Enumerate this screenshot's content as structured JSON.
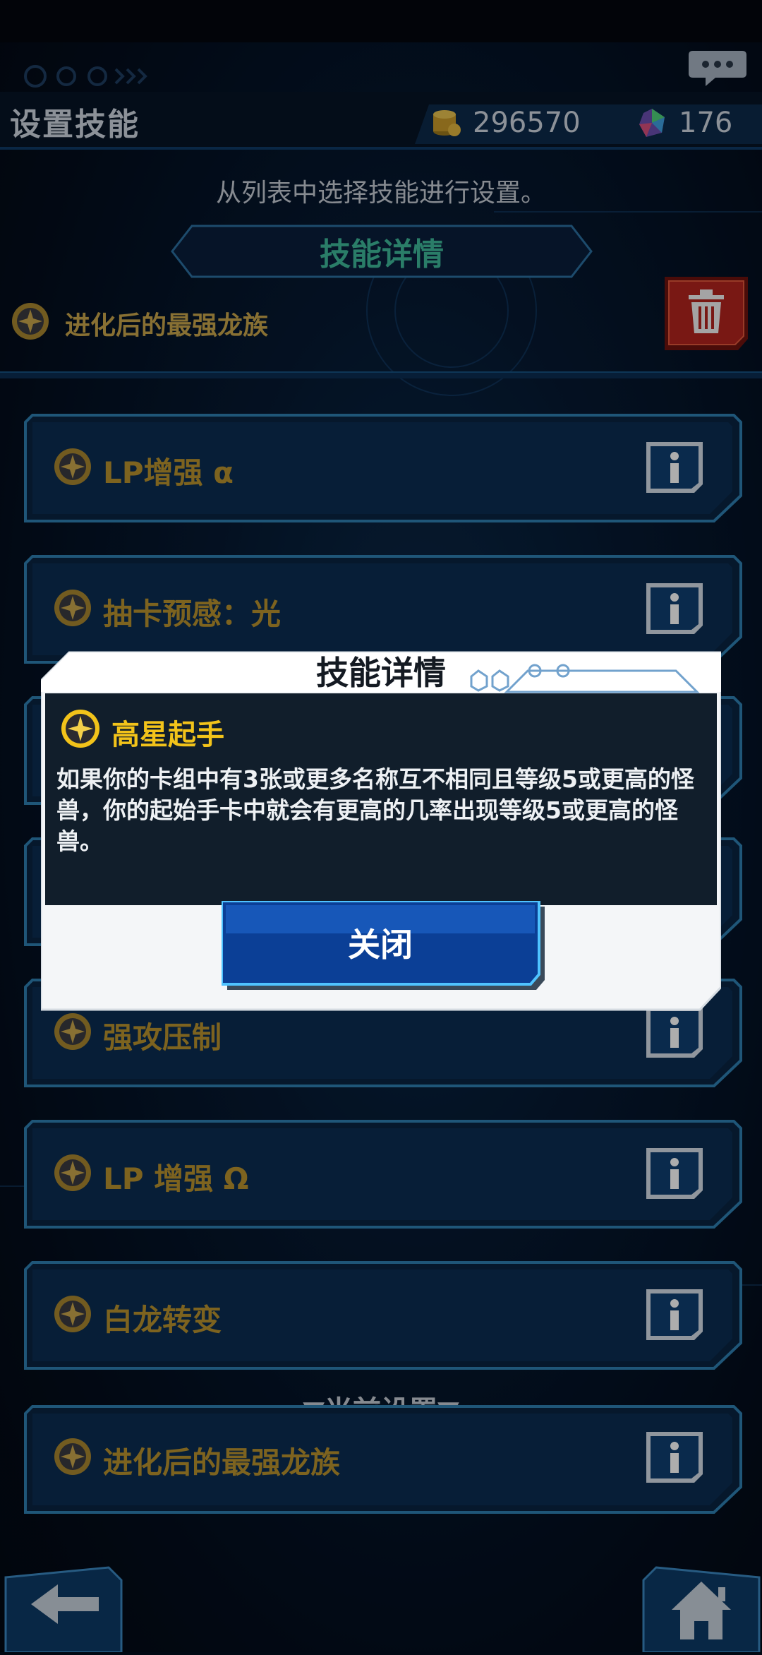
{
  "header": {
    "title": "设置技能",
    "gold_amount": "296570",
    "gem_amount": "176"
  },
  "instruction": "从列表中选择技能进行设置。",
  "detail_banner": "技能详情",
  "current_skill": {
    "name": "进化后的最强龙族"
  },
  "skills": [
    {
      "label": "LP增强 α"
    },
    {
      "label": "抽卡预感：光"
    },
    {
      "label": ""
    },
    {
      "label": ""
    },
    {
      "label": "强攻压制"
    },
    {
      "label": "LP 增强 Ω"
    },
    {
      "label": "白龙转变"
    }
  ],
  "current_section": {
    "label": "▼当前设置▼",
    "skill": "进化后的最强龙族"
  },
  "modal": {
    "title": "技能详情",
    "skill_name": "高星起手",
    "description": "如果你的卡组中有3张或更多名称互不相同且等级5或更高的怪兽，你的起始手卡中就会有更高的几率出现等级5或更高的怪兽。",
    "close_label": "关闭"
  },
  "colors": {
    "accent_gold": "#c9a64c",
    "accent_teal": "#3fb99a",
    "button_blue": "#0b3f96",
    "trash_red": "#b3241e"
  }
}
